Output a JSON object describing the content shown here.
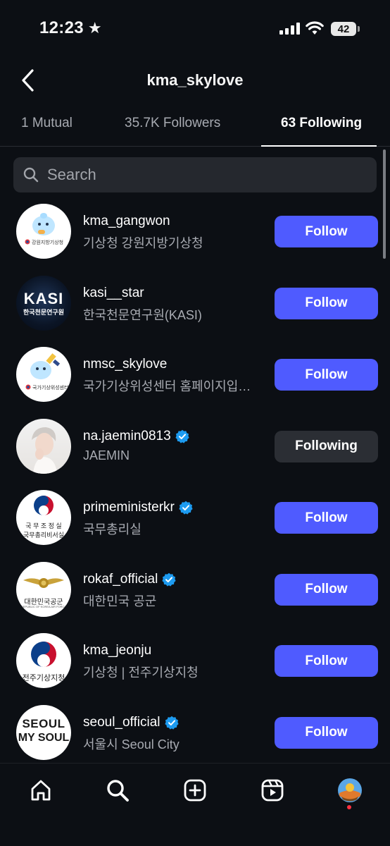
{
  "status": {
    "time": "12:23",
    "battery": "42"
  },
  "header": {
    "title": "kma_skylove"
  },
  "tabs": [
    {
      "label": "1 Mutual"
    },
    {
      "label": "35.7K Followers"
    },
    {
      "label": "63 Following"
    }
  ],
  "search": {
    "placeholder": "Search"
  },
  "accounts": [
    {
      "username": "kma_gangwon",
      "name": "기상청 강원지방기상청",
      "verified": false,
      "button": "Follow",
      "avatar_text": "강원지방기상청"
    },
    {
      "username": "kasi__star",
      "name": "한국천문연구원(KASI)",
      "verified": false,
      "button": "Follow",
      "avatar_text": "KASI",
      "avatar_sub": "한국천문연구원"
    },
    {
      "username": "nmsc_skylove",
      "name": "국가기상위성센터 홈페이지입…",
      "verified": false,
      "button": "Follow",
      "avatar_text": "국가기상위성센터"
    },
    {
      "username": "na.jaemin0813",
      "name": "JAEMIN",
      "verified": true,
      "button": "Following"
    },
    {
      "username": "primeministerkr",
      "name": "국무총리실",
      "verified": true,
      "button": "Follow",
      "avatar_text": "국 무 조 정 실",
      "avatar_sub": "국무총리비서실"
    },
    {
      "username": "rokaf_official",
      "name": "대한민국 공군",
      "verified": true,
      "button": "Follow",
      "avatar_text": "대한민국공군",
      "avatar_sub": "REPUBLIC OF KOREA AIR FORCE"
    },
    {
      "username": "kma_jeonju",
      "name": "기상청 | 전주기상지청",
      "verified": false,
      "button": "Follow",
      "avatar_text": "전주기상지청"
    },
    {
      "username": "seoul_official",
      "name": "서울시 Seoul City",
      "verified": true,
      "button": "Follow",
      "avatar_text": "SEOUL",
      "avatar_sub": "MY SOUL"
    }
  ],
  "nav": [
    "home-icon",
    "search-icon",
    "create-icon",
    "reels-icon",
    "profile-avatar"
  ],
  "colors": {
    "follow_button": "#4f5bff",
    "following_button": "#2b2e34",
    "verified": "#1d9bf0",
    "background": "#0c0f14"
  }
}
